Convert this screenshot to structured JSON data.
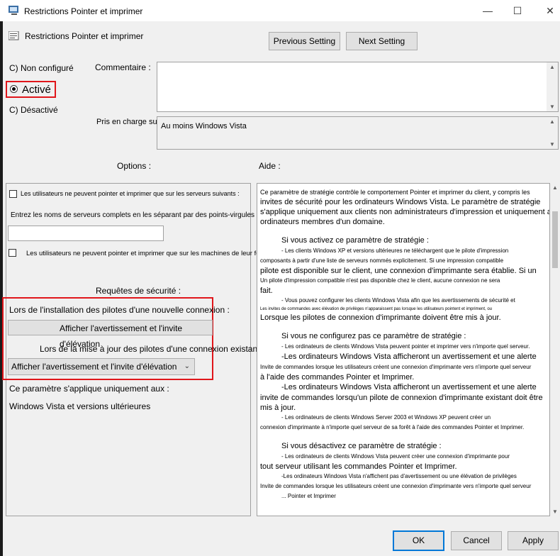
{
  "window": {
    "title": "Restrictions Pointer et imprimer",
    "controls": {
      "minimize": "—",
      "maximize": "☐",
      "close": "✕"
    }
  },
  "header": {
    "policy_name": "Restrictions Pointer et imprimer",
    "prev_button": "Previous Setting",
    "next_button": "Next Setting"
  },
  "state": {
    "not_configured": "C) Non configuré",
    "enabled": "Activé",
    "disabled": "C) Désactivé"
  },
  "comment": {
    "label": "Commentaire :",
    "value": ""
  },
  "supported": {
    "label": "Pris en charge sur :",
    "value": "Au moins Windows Vista"
  },
  "options": {
    "heading": "Options :",
    "check1_label": "Les utilisateurs ne peuvent pointer et imprimer que sur les serveurs suivants :",
    "servers_label": "Entrez les noms de serveurs complets en les séparant par des points-virgules",
    "servers_value": "",
    "check2_label": "Les utilisateurs ne peuvent pointer et imprimer que sur les machines de leur forêt",
    "security_heading": "Requêtes de sécurité :",
    "install_label": "Lors de l'installation des pilotes d'une nouvelle connexion :",
    "install_value": "Afficher l'avertissement et l'invite d'élévation",
    "update_label": "Lors de la mise à jour des pilotes d'une connexion existante :",
    "update_value": "Afficher l'avertissement et l'invite d'élévation",
    "applies_label": "Ce paramètre s'applique uniquement aux :",
    "applies_value": "Windows Vista et versions ultérieures"
  },
  "help": {
    "heading": "Aide :",
    "lines": [
      {
        "t": "Ce paramètre de stratégie contrôle le comportement Pointer et imprimer du client, y compris les",
        "s": "small"
      },
      {
        "t": "invites de sécurité pour les ordinateurs Windows Vista. Le paramètre de stratégie",
        "s": "norm"
      },
      {
        "t": "s'applique uniquement aux clients non administrateurs d'impression et uniquement aux",
        "s": "norm"
      },
      {
        "t": "ordinateurs membres d'un domaine.",
        "s": "norm"
      },
      {
        "t": "",
        "s": "gap"
      },
      {
        "t": "Si vous activez ce paramètre de stratégie :",
        "s": "indent"
      },
      {
        "t": "- Les clients Windows XP et versions ultérieures ne téléchargent que le pilote d'impression",
        "s": "tiny-in"
      },
      {
        "t": "composants à partir d'une liste de serveurs nommés explicitement. Si une impression compatible",
        "s": "tiny"
      },
      {
        "t": "pilote est disponible sur le client, une connexion d'imprimante sera établie. Si un",
        "s": "norm"
      },
      {
        "t": "Un pilote d'impression compatible n'est pas disponible chez le client, aucune connexion ne sera",
        "s": "tiny"
      },
      {
        "t": "fait.",
        "s": "norm"
      },
      {
        "t": "- Vous pouvez configurer les clients Windows Vista afin que les avertissements de sécurité et",
        "s": "tiny-in"
      },
      {
        "t": "Les invites de commandes avec élévation de privilèges n'apparaissent pas lorsque les utilisateurs pointent et impriment, ou",
        "s": "micro"
      },
      {
        "t": "Lorsque les pilotes de connexion d'imprimante doivent être mis à jour.",
        "s": "norm"
      },
      {
        "t": "",
        "s": "gap"
      },
      {
        "t": "Si vous ne configurez pas ce paramètre de stratégie :",
        "s": "indent"
      },
      {
        "t": "- Les ordinateurs de clients Windows Vista peuvent pointer et imprimer vers n'importe quel serveur.",
        "s": "tiny-in"
      },
      {
        "t": "-Les ordinateurs Windows Vista afficheront un avertissement et une alerte",
        "s": "indent"
      },
      {
        "t": "Invite de commandes lorsque les utilisateurs créent une connexion d'imprimante vers n'importe quel serveur",
        "s": "tiny"
      },
      {
        "t": "à l'aide des commandes Pointer et Imprimer.",
        "s": "norm"
      },
      {
        "t": "-Les ordinateurs Windows Vista afficheront un avertissement et une alerte",
        "s": "indent"
      },
      {
        "t": "invite de commandes lorsqu'un pilote de connexion d'imprimante existant doit être",
        "s": "norm"
      },
      {
        "t": "mis à jour.",
        "s": "norm"
      },
      {
        "t": "- Les ordinateurs de clients Windows Server 2003 et Windows XP peuvent créer un",
        "s": "tiny-in"
      },
      {
        "t": "connexion d'imprimante à n'importe quel serveur de sa forêt à l'aide des commandes Pointer et Imprimer.",
        "s": "tiny"
      },
      {
        "t": "",
        "s": "gap"
      },
      {
        "t": "Si vous désactivez ce paramètre de stratégie :",
        "s": "indent"
      },
      {
        "t": "- Les ordinateurs de clients Windows Vista peuvent créer une connexion d'imprimante pour",
        "s": "tiny-in"
      },
      {
        "t": "tout serveur utilisant les commandes Pointer et Imprimer.",
        "s": "norm"
      },
      {
        "t": "-Les ordinateurs Windows Vista n'affichent pas d'avertissement ou une élévation de privilèges",
        "s": "tiny-in"
      },
      {
        "t": "Invite de commandes lorsque les utilisateurs créent une connexion d'imprimante vers n'importe quel serveur",
        "s": "tiny"
      },
      {
        "t": "... Pointer et Imprimer",
        "s": "tiny-in"
      }
    ]
  },
  "footer": {
    "ok": "OK",
    "cancel": "Cancel",
    "apply": "Apply"
  }
}
